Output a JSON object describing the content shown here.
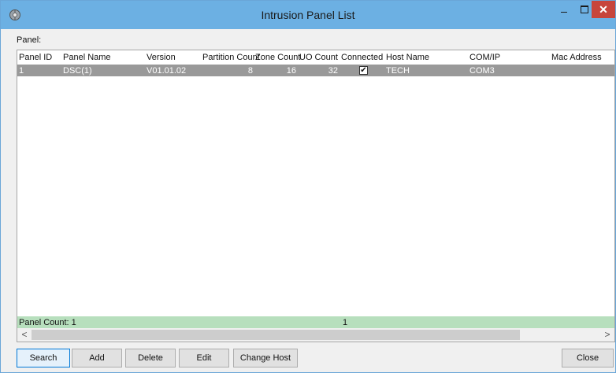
{
  "window": {
    "title": "Intrusion Panel List"
  },
  "titlebar": {
    "minimize_glyph": "–",
    "close_glyph": "✕"
  },
  "panel_label": "Panel:",
  "table": {
    "headers": [
      "Panel ID",
      "Panel Name",
      "Version",
      "Partition Count",
      "Zone Count",
      "UO Count",
      "Connected",
      "Host Name",
      "COM/IP",
      "Mac Address"
    ],
    "rows": [
      {
        "panel_id": "1",
        "panel_name": "DSC(1)",
        "version": "V01.01.02",
        "partition_count": "8",
        "zone_count": "16",
        "uo_count": "32",
        "connected": true,
        "host_name": "TECH",
        "com_ip": "COM3",
        "mac_address": ""
      }
    ],
    "footer": {
      "panel_count_label": "Panel Count: 1",
      "connected_total": "1"
    }
  },
  "scrollbar": {
    "left_arrow": "<",
    "right_arrow": ">"
  },
  "buttons": {
    "search": "Search",
    "add": "Add",
    "delete": "Delete",
    "edit": "Edit",
    "change_host": "Change Host",
    "close": "Close"
  },
  "colors": {
    "titlebar": "#6cb0e3",
    "selected_row": "#999999",
    "footer_row": "#b7dfbd",
    "close_button": "#c7453c"
  },
  "icons": {
    "app": "panel-app-icon",
    "check": "checkmark"
  }
}
